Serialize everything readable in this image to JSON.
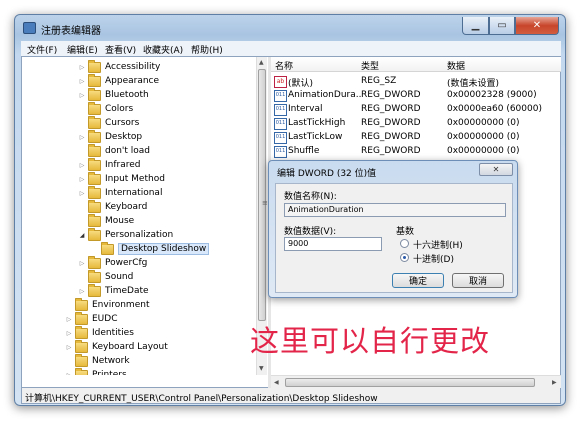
{
  "window": {
    "title": "注册表编辑器"
  },
  "menu": [
    "文件(F)",
    "编辑(E)",
    "查看(V)",
    "收藏夹(A)",
    "帮助(H)"
  ],
  "tree": [
    {
      "label": "Accessibility",
      "depth": 4,
      "expand": "collapsed"
    },
    {
      "label": "Appearance",
      "depth": 4,
      "expand": "collapsed"
    },
    {
      "label": "Bluetooth",
      "depth": 4,
      "expand": "collapsed"
    },
    {
      "label": "Colors",
      "depth": 4,
      "expand": "none"
    },
    {
      "label": "Cursors",
      "depth": 4,
      "expand": "none"
    },
    {
      "label": "Desktop",
      "depth": 4,
      "expand": "collapsed"
    },
    {
      "label": "don't load",
      "depth": 4,
      "expand": "none"
    },
    {
      "label": "Infrared",
      "depth": 4,
      "expand": "collapsed"
    },
    {
      "label": "Input Method",
      "depth": 4,
      "expand": "collapsed"
    },
    {
      "label": "International",
      "depth": 4,
      "expand": "collapsed"
    },
    {
      "label": "Keyboard",
      "depth": 4,
      "expand": "none"
    },
    {
      "label": "Mouse",
      "depth": 4,
      "expand": "none"
    },
    {
      "label": "Personalization",
      "depth": 4,
      "expand": "expanded"
    },
    {
      "label": "Desktop Slideshow",
      "depth": 5,
      "expand": "none",
      "selected": true
    },
    {
      "label": "PowerCfg",
      "depth": 4,
      "expand": "collapsed"
    },
    {
      "label": "Sound",
      "depth": 4,
      "expand": "none"
    },
    {
      "label": "TimeDate",
      "depth": 4,
      "expand": "collapsed"
    },
    {
      "label": "Environment",
      "depth": 3,
      "expand": "none"
    },
    {
      "label": "EUDC",
      "depth": 3,
      "expand": "collapsed"
    },
    {
      "label": "Identities",
      "depth": 3,
      "expand": "collapsed"
    },
    {
      "label": "Keyboard Layout",
      "depth": 3,
      "expand": "collapsed"
    },
    {
      "label": "Network",
      "depth": 3,
      "expand": "none"
    },
    {
      "label": "Printers",
      "depth": 3,
      "expand": "collapsed"
    }
  ],
  "list": {
    "headers": {
      "name": "名称",
      "type": "类型",
      "data": "数据"
    },
    "rows": [
      {
        "icon": "string-value-icon",
        "name": "(默认)",
        "type": "REG_SZ",
        "data": "(数值未设置)"
      },
      {
        "icon": "binary-value-icon",
        "name": "AnimationDura...",
        "type": "REG_DWORD",
        "data": "0x00002328 (9000)"
      },
      {
        "icon": "binary-value-icon",
        "name": "Interval",
        "type": "REG_DWORD",
        "data": "0x0000ea60 (60000)"
      },
      {
        "icon": "binary-value-icon",
        "name": "LastTickHigh",
        "type": "REG_DWORD",
        "data": "0x00000000 (0)"
      },
      {
        "icon": "binary-value-icon",
        "name": "LastTickLow",
        "type": "REG_DWORD",
        "data": "0x00000000 (0)"
      },
      {
        "icon": "binary-value-icon",
        "name": "Shuffle",
        "type": "REG_DWORD",
        "data": "0x00000000 (0)"
      }
    ]
  },
  "status": "计算机\\HKEY_CURRENT_USER\\Control Panel\\Personalization\\Desktop Slideshow",
  "dialog": {
    "title": "编辑 DWORD (32 位)值",
    "name_label": "数值名称(N):",
    "name_value": "AnimationDuration",
    "data_label": "数值数据(V):",
    "data_value": "9000",
    "base_label": "基数",
    "hex_label": "十六进制(H)",
    "dec_label": "十进制(D)",
    "base_selected": "decimal",
    "ok_label": "确定",
    "cancel_label": "取消"
  },
  "annotation": "这里可以自行更改"
}
